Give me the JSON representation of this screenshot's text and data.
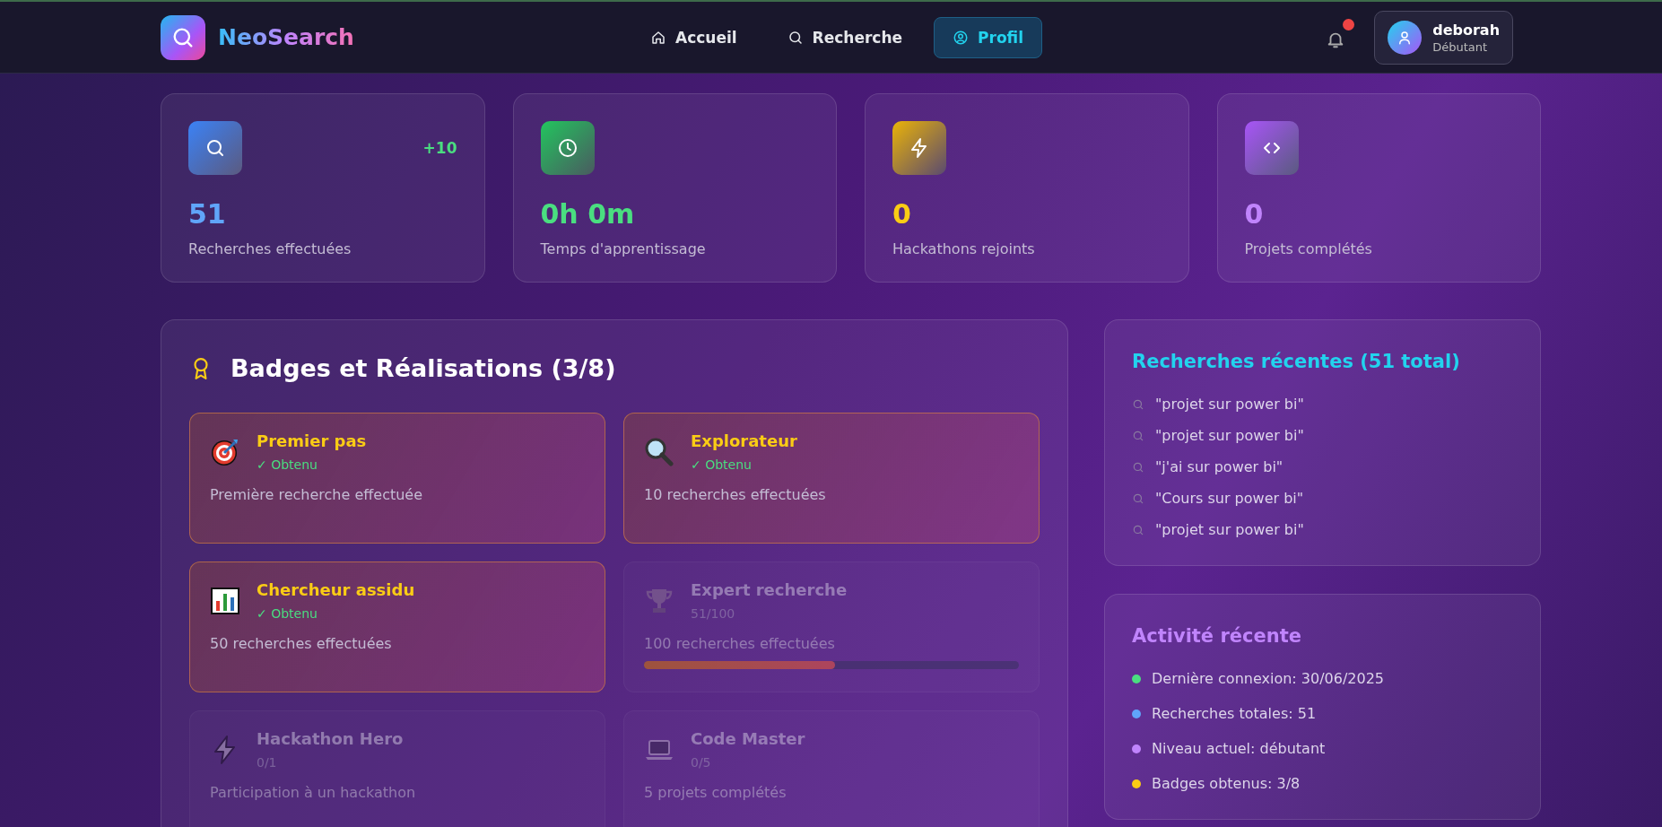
{
  "app": {
    "name": "NeoSearch"
  },
  "nav": [
    {
      "label": "Accueil",
      "selected": false
    },
    {
      "label": "Recherche",
      "selected": false
    },
    {
      "label": "Profil",
      "selected": true
    }
  ],
  "notifications": {
    "unread": true
  },
  "user": {
    "name": "deborah",
    "level": "Débutant"
  },
  "stats": [
    {
      "value": "51",
      "label": "Recherches effectuées",
      "delta": "+10",
      "color": "#60a5fa"
    },
    {
      "value": "0h 0m",
      "label": "Temps d'apprentissage",
      "color": "#4ade80"
    },
    {
      "value": "0",
      "label": "Hackathons rejoints",
      "color": "#facc15"
    },
    {
      "value": "0",
      "label": "Projets complétés",
      "color": "#c084fc"
    }
  ],
  "badges": {
    "title": "Badges et Réalisations (3/8)",
    "items": [
      {
        "name": "Premier pas",
        "status": "✓ Obtenu",
        "description": "Première recherche effectuée",
        "earned": true
      },
      {
        "name": "Explorateur",
        "status": "✓ Obtenu",
        "description": "10 recherches effectuées",
        "earned": true
      },
      {
        "name": "Chercheur assidu",
        "status": "✓ Obtenu",
        "description": "50 recherches effectuées",
        "earned": true
      },
      {
        "name": "Expert recherche",
        "status": "51/100",
        "description": "100 recherches effectuées",
        "earned": false,
        "level": 0.51
      },
      {
        "name": "Hackathon Hero",
        "status": "0/1",
        "description": "Participation à un hackathon",
        "earned": false
      },
      {
        "name": "Code Master",
        "status": "0/5",
        "description": "5 projets complétés",
        "earned": false
      }
    ]
  },
  "recent_searches": {
    "title": "Recherches récentes (51 total)",
    "items": [
      "\"projet sur power bi\"",
      "\"projet sur power bi\"",
      "\"j'ai sur power bi\"",
      "\"Cours sur power bi\"",
      "\"projet sur power bi\""
    ]
  },
  "recent_activity": {
    "title": "Activité récente",
    "items": [
      {
        "text": "Dernière connexion: 30/06/2025",
        "color": "#4ade80"
      },
      {
        "text": "Recherches totales: 51",
        "color": "#60a5fa"
      },
      {
        "text": "Niveau actuel: débutant",
        "color": "#c084fc"
      },
      {
        "text": "Badges obtenus: 3/8",
        "color": "#facc15"
      }
    ]
  }
}
